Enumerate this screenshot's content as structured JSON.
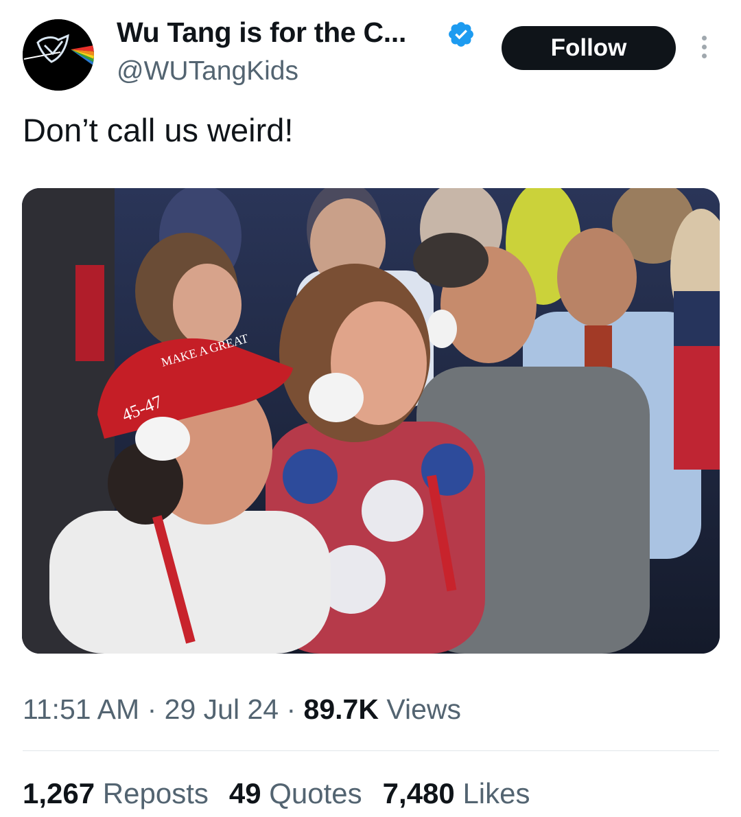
{
  "author": {
    "display_name": "Wu Tang is for the C...",
    "handle": "@WUTangKids",
    "verified": true,
    "avatar_icon": "wu-tang-prism-logo"
  },
  "follow_label": "Follow",
  "tweet_text": "Don’t call us weird!",
  "media": {
    "type": "photo",
    "badge_text": "45-47",
    "hat_text": "MAKE A GREAT"
  },
  "meta": {
    "time": "11:51 AM",
    "separator": "·",
    "date": "29 Jul 24",
    "views_count": "89.7K",
    "views_label": "Views"
  },
  "stats": {
    "reposts_count": "1,267",
    "reposts_label": "Reposts",
    "quotes_count": "49",
    "quotes_label": "Quotes",
    "likes_count": "7,480",
    "likes_label": "Likes"
  },
  "colors": {
    "text_primary": "#0f1419",
    "text_secondary": "#536471",
    "verified_blue": "#1d9bf0",
    "follow_bg": "#0f1419"
  }
}
